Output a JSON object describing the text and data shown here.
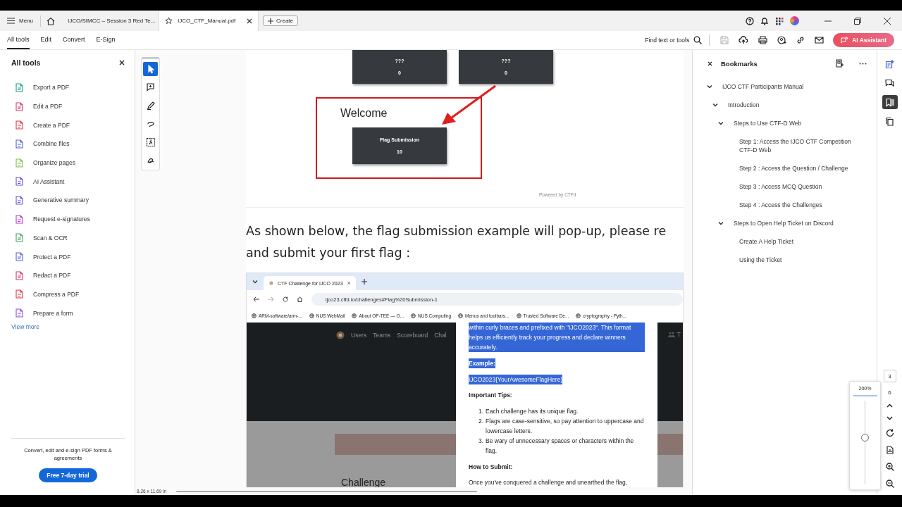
{
  "titlebar": {
    "menu": "Menu",
    "tabs": [
      {
        "label": "IJCO/SIMCC – Session 3 Red Te...",
        "selected": false
      },
      {
        "label": "IJCO_CTF_Manual.pdf",
        "selected": true
      }
    ],
    "create": "Create"
  },
  "toolbar": {
    "tabs": [
      {
        "label": "All tools",
        "selected": true
      },
      {
        "label": "Edit",
        "selected": false
      },
      {
        "label": "Convert",
        "selected": false
      },
      {
        "label": "E-Sign",
        "selected": false
      }
    ],
    "search": "Find text or tools",
    "ai_button": "AI Assistant"
  },
  "tools_panel": {
    "title": "All tools",
    "items": [
      {
        "label": "Export a PDF",
        "color": "#1a9c8c"
      },
      {
        "label": "Edit a PDF",
        "color": "#d1386d"
      },
      {
        "label": "Create a PDF",
        "color": "#d9363e"
      },
      {
        "label": "Combine files",
        "color": "#5a5fd6"
      },
      {
        "label": "Organize pages",
        "color": "#7fbf3f"
      },
      {
        "label": "AI Assistant",
        "color": "#6e4fd8"
      },
      {
        "label": "Generative summary",
        "color": "#6e4fd8"
      },
      {
        "label": "Request e-signatures",
        "color": "#b33fc7"
      },
      {
        "label": "Scan & OCR",
        "color": "#3ca55c"
      },
      {
        "label": "Protect a PDF",
        "color": "#5a5fd6"
      },
      {
        "label": "Redact a PDF",
        "color": "#d1386d"
      },
      {
        "label": "Compress a PDF",
        "color": "#d9363e"
      },
      {
        "label": "Prepare a form",
        "color": "#8a4fd8"
      }
    ],
    "view_more": "View more",
    "promo": "Convert, edit and e-sign PDF forms & agreements",
    "trial_button": "Free 7-day trial"
  },
  "quick_tools": [
    {
      "kind": "pointer",
      "selected": true
    },
    {
      "kind": "comment",
      "selected": false
    },
    {
      "kind": "pen",
      "selected": false
    },
    {
      "kind": "lasso",
      "selected": false
    },
    {
      "kind": "text-select",
      "selected": false
    },
    {
      "kind": "signature",
      "selected": false
    }
  ],
  "document": {
    "figure": {
      "cards": [
        {
          "title": "???",
          "value": "0"
        },
        {
          "title": "???",
          "value": "0"
        }
      ],
      "welcome": "Welcome",
      "highlight_card": {
        "title": "Flag Submission",
        "value": "10"
      },
      "footer": "Powered by CTFd"
    },
    "paragraph_lines": [
      "As shown below, the flag submission example will pop-up, please re",
      "and submit your first flag :"
    ],
    "browser": {
      "tab": "CTF Challenge for IJCO 2023",
      "url": "ijco23.ctfd.io/challenges#Flag%20Submission-1",
      "bookmarks": [
        "ARM-software/arm-...",
        "NUS WebMail",
        "About OP-TEE — O...",
        "NUS Computing",
        "Menus and toolbars...",
        "Trusted Software De...",
        "cryptography - Pyth..."
      ],
      "nav": [
        "Users",
        "Teams",
        "Scoreboard",
        "Chal"
      ],
      "nav_right": "T",
      "popup": {
        "highlight": "within curly braces and prefixed with \"IJCO2023\". This format helps us efficiently track your progress and declare winners accurately.",
        "example_label": "Example:",
        "example": "IJCO2023{YourAwesomeFlagHere}",
        "tips_title": "Important Tips:",
        "tips": [
          {
            "number": "1.",
            "text": "Each challenge has its unique flag."
          },
          {
            "number": "2.",
            "text": "Flags are case-sensitive, so pay attention to uppercase and lowercase letters."
          },
          {
            "number": "3.",
            "text": "Be wary of unnecessary spaces or characters within the flag."
          }
        ],
        "submit_title": "How to Submit:",
        "submit_text": "Once you've conquered a challenge and unearthed the flag,"
      },
      "heading": "Challenge"
    },
    "page_size": "8.26 x 11.69 in"
  },
  "bookmarks": {
    "title": "Bookmarks",
    "items": [
      {
        "label": "IJCO CTF Participants Manual",
        "expanded": true,
        "children": [
          {
            "label": "Introduction",
            "expanded": true,
            "children": [
              {
                "label": "Steps to Use CTF-D Web",
                "expanded": true,
                "children": [
                  {
                    "label": "Step 1: Access the IJCO CTF Competition CTF-D Web"
                  },
                  {
                    "label": "Step 2 : Access the Question / Challenge"
                  },
                  {
                    "label": "Step 3 : Access MCQ Question"
                  },
                  {
                    "label": "Step 4 : Access the Challenges"
                  }
                ]
              },
              {
                "label": "Steps to Open Help Ticket on Discord",
                "expanded": true,
                "children": [
                  {
                    "label": "Create A Help Ticket"
                  },
                  {
                    "label": "Using the Ticket"
                  }
                ]
              }
            ]
          }
        ]
      }
    ]
  },
  "side_rail": [
    {
      "kind": "summary",
      "selected": false
    },
    {
      "kind": "comments",
      "selected": false
    },
    {
      "kind": "bookmarks",
      "selected": true
    },
    {
      "kind": "pages",
      "selected": false
    }
  ],
  "page_nav": {
    "current": "3",
    "total": "6"
  },
  "zoom": {
    "label": "200%",
    "level": 0.55
  }
}
